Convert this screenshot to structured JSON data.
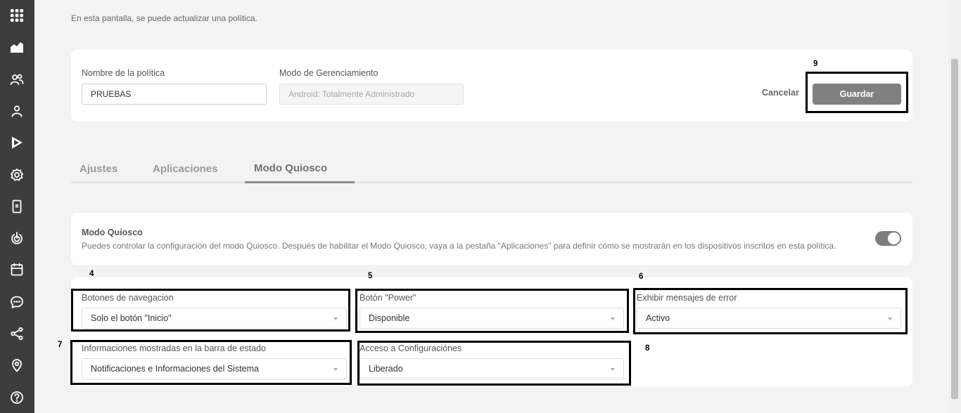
{
  "intro_text": "En esta pantalla, se puede actualizar una política.",
  "sidebar": {
    "items": [
      {
        "icon": "apps-grid-icon"
      },
      {
        "icon": "dashboard-icon"
      },
      {
        "icon": "groups-icon"
      },
      {
        "icon": "user-icon"
      },
      {
        "icon": "play-store-icon"
      },
      {
        "icon": "settings-gear-icon"
      },
      {
        "icon": "device-icon"
      },
      {
        "icon": "power-icon"
      },
      {
        "icon": "calendar-icon"
      },
      {
        "icon": "chat-icon"
      },
      {
        "icon": "share-icon"
      },
      {
        "icon": "location-pin-icon"
      },
      {
        "icon": "help-icon"
      }
    ]
  },
  "policy": {
    "name_label": "Nombre de la política",
    "name_value": "PRUEBAS",
    "mode_label": "Modo de Gerenciamiento",
    "mode_placeholder": "Android: Totalmente Administrado",
    "cancel_label": "Cancelar",
    "save_label": "Guardar"
  },
  "tabs": [
    {
      "label": "Ajustes",
      "active": false
    },
    {
      "label": "Aplicaciones",
      "active": false
    },
    {
      "label": "Modo Quiosco",
      "active": true
    }
  ],
  "kiosk": {
    "title": "Modo Quiosco",
    "description": "Puedes controlar la configuración del modo Quiosco. Después de habilitar el Modo Quiosco, vaya a la pestaña \"Aplicaciones\" para definir cómo se mostrarán en los dispositivos inscritos en esta política.",
    "enabled": true
  },
  "settings": {
    "nav_buttons": {
      "label": "Botones de navegacion",
      "value": "Solo el botón \"Inicio\""
    },
    "power_button": {
      "label": "Botón \"Power\"",
      "value": "Disponible"
    },
    "error_messages": {
      "label": "Exhibir mensajes de error",
      "value": "Activo"
    },
    "status_bar": {
      "label": "Informaciones mostradas en la barra de estado",
      "value": "Notificaciones e Informaciones del Sistema"
    },
    "settings_access": {
      "label": "Acceso a Configuraciónes",
      "value": "Liberado"
    }
  },
  "annotations": {
    "n4": "4",
    "n5": "5",
    "n6": "6",
    "n7": "7",
    "n8": "8",
    "n9": "9"
  },
  "colors": {
    "sidebar_bg": "#3d3d3d",
    "page_bg": "#f3f3f3",
    "save_button_bg": "#808080"
  }
}
